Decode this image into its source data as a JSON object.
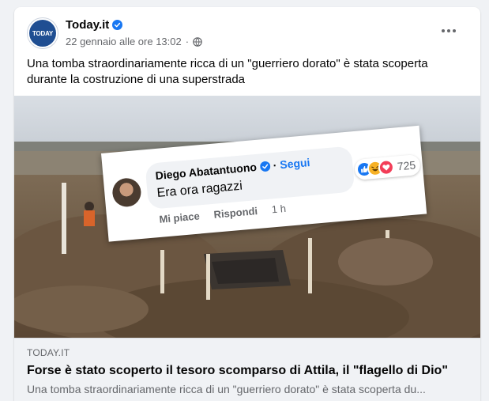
{
  "post": {
    "page_name": "Today.it",
    "avatar_text": "TODAY",
    "date": "22 gennaio alle ore 13:02",
    "separator": "·",
    "caption": "Una tomba straordinariamente ricca di un \"guerriero dorato\" è stata scoperta durante la costruzione di una superstrada"
  },
  "link": {
    "domain": "TODAY.IT",
    "title": "Forse è stato scoperto il tesoro scomparso di Attila, il \"flagello di Dio\"",
    "description": "Una tomba straordinariamente ricca di un \"guerriero dorato\" è stata scoperta du..."
  },
  "comment": {
    "author": "Diego Abatantuono",
    "separator": "·",
    "follow": "Segui",
    "text": "Era ora ragazzi",
    "reaction_count": "725",
    "like": "Mi piace",
    "reply": "Rispondi",
    "time": "1 h"
  },
  "colors": {
    "brand_blue": "#1877f2",
    "text_secondary": "#65676b",
    "today_blue": "#1f4e92"
  },
  "icons": [
    "verified-badge-icon",
    "globe-icon",
    "more-options-icon",
    "like-reaction-icon",
    "haha-reaction-icon",
    "love-reaction-icon"
  ]
}
